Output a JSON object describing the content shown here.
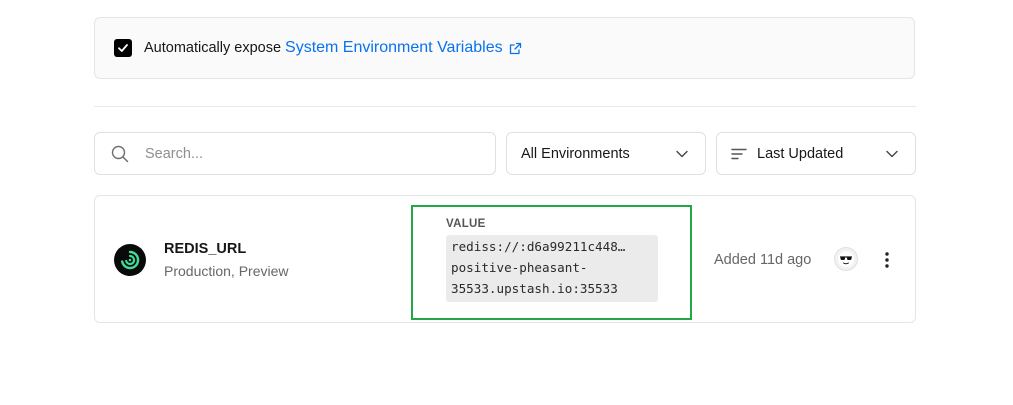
{
  "expose": {
    "checked": true,
    "text": "Automatically expose",
    "link_text": "System Environment Variables",
    "icon": "external-link-icon"
  },
  "toolbar": {
    "search_placeholder": "Search...",
    "environment_select": "All Environments",
    "sort_select": "Last Updated"
  },
  "variables": [
    {
      "name": "REDIS_URL",
      "environments": "Production, Preview",
      "value_label": "VALUE",
      "value_lines": [
        "rediss://:d6a99211c448…",
        "positive-pheasant-",
        "35533.upstash.io:35533"
      ],
      "added": "Added 11d ago"
    }
  ],
  "colors": {
    "link": "#0a72ef",
    "highlight": "#22a846",
    "logo_accent": "#3ddc97"
  }
}
